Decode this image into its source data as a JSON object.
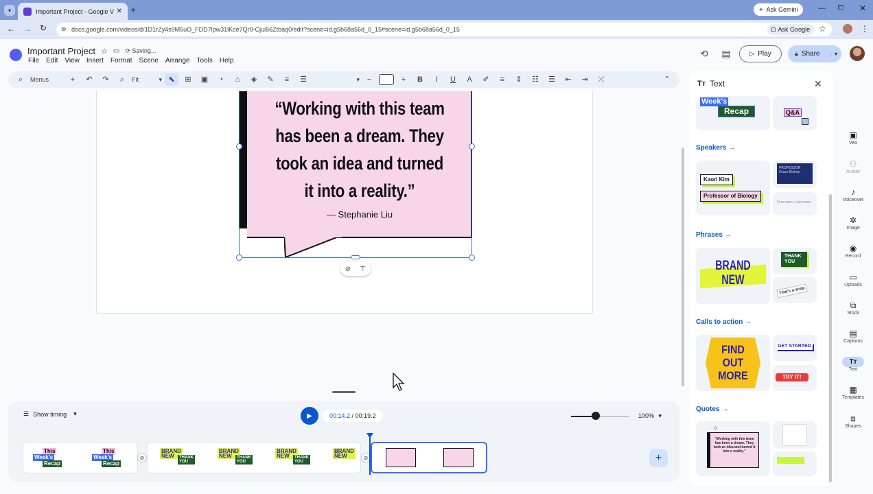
{
  "browser": {
    "tab_title": "Important Project - Google Vids",
    "url": "docs.google.com/videos/d/1D1rZy4s9M5uO_FDD7lpw31lKce7Qr0-Cjui56Ztbaq0/edit?scene=id.g5b68a56d_0_15#scene=id.g5b68a56d_0_15",
    "ask_gemini": "Ask Gemini",
    "ask_google": "Ask Google"
  },
  "app": {
    "title": "Important Project",
    "status": "Saving...",
    "menus": [
      "File",
      "Edit",
      "View",
      "Insert",
      "Format",
      "Scene",
      "Arrange",
      "Tools",
      "Help"
    ],
    "play_label": "Play",
    "share_label": "Share"
  },
  "toolbar": {
    "menus_label": "Menus",
    "fit_label": "Fit"
  },
  "canvas": {
    "quote_text": "“Working with this team has been a dream. They took an idea and turned it into a reality.”",
    "quote_author": "— Stephanie Liu"
  },
  "timeline": {
    "show_timing": "Show timing",
    "current_time": "00:14.2",
    "separator": " / ",
    "total_time": "00:19.2",
    "zoom": "100%",
    "zoom_fraction": 0.43,
    "clip_text": {
      "this": "This",
      "weeks": "Week's",
      "recap": "Recap",
      "brand": "BRAND",
      "new": "NEW",
      "thank": "THANK",
      "you": "YOU"
    }
  },
  "panel": {
    "title": "Text",
    "sections": {
      "speakers": "Speakers →",
      "phrases": "Phrases →",
      "cta": "Calls to action →",
      "quotes": "Quotes →"
    },
    "cards": {
      "weeks": "Week's",
      "recap": "Recap",
      "qa": "Q&A",
      "speaker_name": "Kaori Kim",
      "speaker_role": "Professor of Biology",
      "speaker2_name": "Grace Bishop",
      "speaker2_role": "PROFESSOR",
      "speaker3": "First name, Last name",
      "brand_new": "BRAND NEW",
      "thank_you": "THANK YOU",
      "thats_a_wrap": "That's a wrap",
      "find_out_more": "FIND OUT MORE",
      "get_started": "GET STARTED",
      "try_it": "TRY IT!",
      "quote_mini": "“Working with this team has been a dream. They took an idea and turned it into a reality.”"
    }
  },
  "rail": [
    "Veo",
    "Avatar",
    "Voiceover",
    "Image",
    "Record",
    "Uploads",
    "Stock",
    "Captions",
    "Text",
    "Templates",
    "Shapes"
  ]
}
